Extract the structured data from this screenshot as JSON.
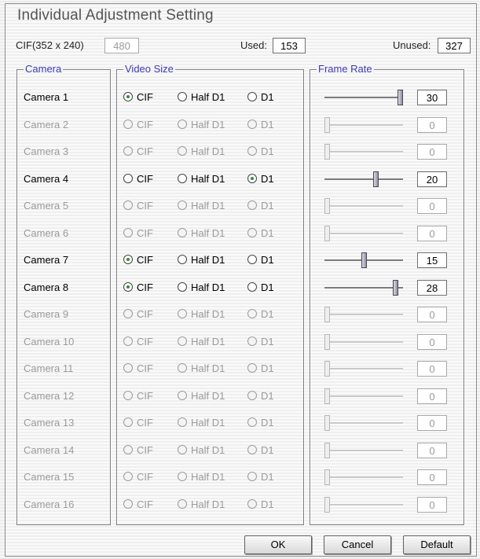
{
  "title": "Individual Adjustment Setting",
  "summary": {
    "cif_label": "CIF(352 x 240)",
    "cif_value": "480",
    "used_label": "Used:",
    "used_value": "153",
    "unused_label": "Unused:",
    "unused_value": "327"
  },
  "groups": {
    "camera": "Camera",
    "video_size": "Video Size",
    "frame_rate": "Frame Rate"
  },
  "options": {
    "cif": "CIF",
    "half_d1": "Half D1",
    "d1": "D1"
  },
  "frame_rate_max": 30,
  "cameras": [
    {
      "name": "Camera 1",
      "enabled": true,
      "size": "cif",
      "fps": "30"
    },
    {
      "name": "Camera 2",
      "enabled": false,
      "size": "none",
      "fps": "0"
    },
    {
      "name": "Camera 3",
      "enabled": false,
      "size": "none",
      "fps": "0"
    },
    {
      "name": "Camera 4",
      "enabled": true,
      "size": "d1",
      "fps": "20"
    },
    {
      "name": "Camera 5",
      "enabled": false,
      "size": "none",
      "fps": "0"
    },
    {
      "name": "Camera 6",
      "enabled": false,
      "size": "none",
      "fps": "0"
    },
    {
      "name": "Camera 7",
      "enabled": true,
      "size": "cif",
      "fps": "15"
    },
    {
      "name": "Camera 8",
      "enabled": true,
      "size": "cif",
      "fps": "28"
    },
    {
      "name": "Camera 9",
      "enabled": false,
      "size": "none",
      "fps": "0"
    },
    {
      "name": "Camera 10",
      "enabled": false,
      "size": "none",
      "fps": "0"
    },
    {
      "name": "Camera 11",
      "enabled": false,
      "size": "none",
      "fps": "0"
    },
    {
      "name": "Camera 12",
      "enabled": false,
      "size": "none",
      "fps": "0"
    },
    {
      "name": "Camera 13",
      "enabled": false,
      "size": "none",
      "fps": "0"
    },
    {
      "name": "Camera 14",
      "enabled": false,
      "size": "none",
      "fps": "0"
    },
    {
      "name": "Camera 15",
      "enabled": false,
      "size": "none",
      "fps": "0"
    },
    {
      "name": "Camera 16",
      "enabled": false,
      "size": "none",
      "fps": "0"
    }
  ],
  "buttons": {
    "ok": "OK",
    "cancel": "Cancel",
    "default": "Default"
  },
  "colors": {
    "legend": "#3b3bb3",
    "checked_dot": "#2f8a3a",
    "disabled_text": "#9b9b9b"
  }
}
